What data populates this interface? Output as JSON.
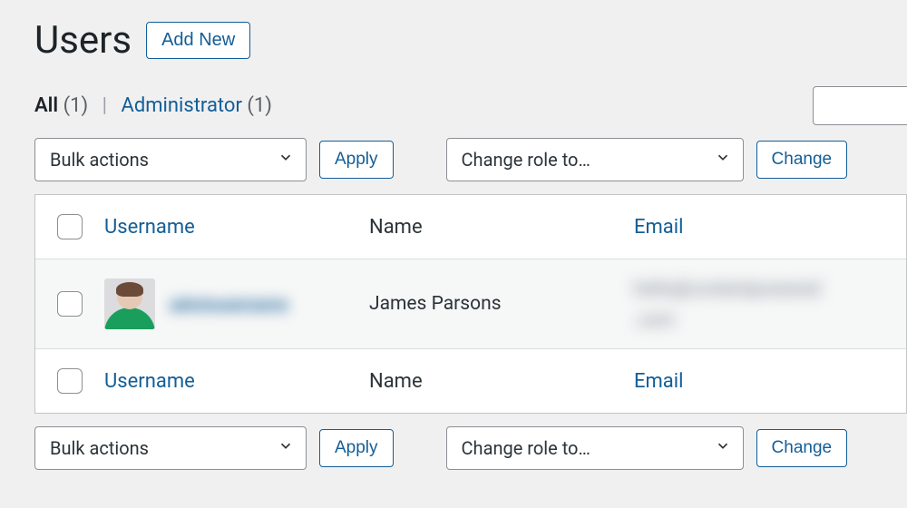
{
  "header": {
    "title": "Users",
    "add_new": "Add New"
  },
  "filters": {
    "all_label": "All",
    "all_count": "(1)",
    "separator": "|",
    "administrator_label": "Administrator",
    "administrator_count": "(1)"
  },
  "search": {
    "placeholder": ""
  },
  "bulk": {
    "actions_label": "Bulk actions",
    "apply_label": "Apply",
    "change_role_label": "Change role to…",
    "change_label": "Change"
  },
  "table": {
    "headers": {
      "username": "Username",
      "name": "Name",
      "email": "Email"
    },
    "row": {
      "username_masked": "adminusername",
      "name": "James Parsons",
      "email_masked_line1": "hello@contentpowered",
      "email_masked_line2": ".com"
    }
  }
}
